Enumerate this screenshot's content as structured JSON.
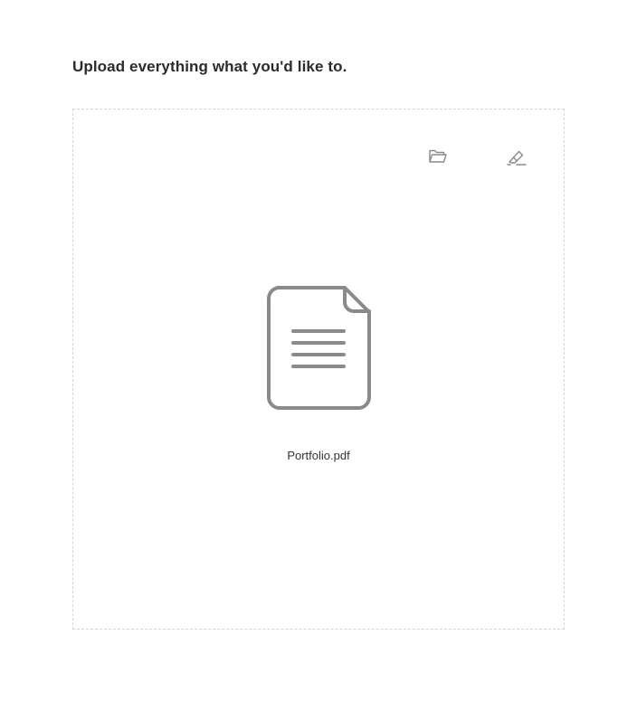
{
  "heading": "Upload everything what you'd like to.",
  "upload": {
    "browse_icon": "folder-open-icon",
    "clear_icon": "eraser-icon",
    "file_icon": "document-icon",
    "file_name": "Portfolio.pdf"
  },
  "colors": {
    "heading_text": "#2b2b2b",
    "border_dashed": "#d4d4d4",
    "icon_gray": "#8a8a8a",
    "file_name_text": "#333333"
  }
}
